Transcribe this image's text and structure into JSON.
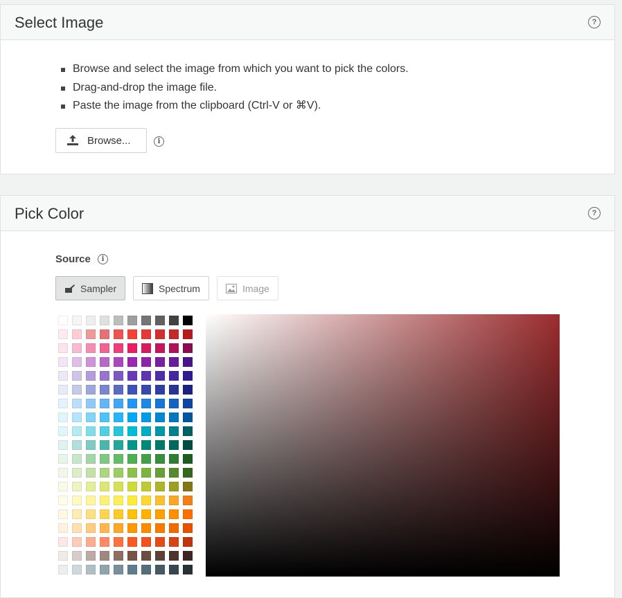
{
  "select_image": {
    "title": "Select Image",
    "instructions": [
      "Browse and select the image from which you want to pick the colors.",
      "Drag-and-drop the image file.",
      "Paste the image from the clipboard (Ctrl-V or ⌘V)."
    ],
    "browse_label": "Browse...",
    "help_icon": "question-circle-icon",
    "info_icon": "info-circle-icon"
  },
  "pick_color": {
    "title": "Pick Color",
    "source_label": "Source",
    "source_options": [
      {
        "label": "Sampler",
        "icon": "sampler-icon",
        "state": "active"
      },
      {
        "label": "Spectrum",
        "icon": "spectrum-icon",
        "state": "normal"
      },
      {
        "label": "Image",
        "icon": "image-icon",
        "state": "disabled"
      }
    ],
    "spectrum_hue_color": "#9b2c2e",
    "palette": [
      [
        "#ffffff",
        "#f5f5f5",
        "#eeeeee",
        "#e0e0e0",
        "#bdbdbd",
        "#9e9e9e",
        "#757575",
        "#616161",
        "#424242",
        "#000000"
      ],
      [
        "#ffebee",
        "#ffcdd2",
        "#ef9a9a",
        "#e57373",
        "#ef5350",
        "#f44336",
        "#e53935",
        "#d32f2f",
        "#c62828",
        "#b71c1c"
      ],
      [
        "#fce4ec",
        "#f8bbd0",
        "#f48fb1",
        "#f06292",
        "#ec407a",
        "#e91e63",
        "#d81b60",
        "#c2185b",
        "#ad1457",
        "#880e4f"
      ],
      [
        "#f3e5f5",
        "#e1bee7",
        "#ce93d8",
        "#ba68c8",
        "#ab47bc",
        "#9c27b0",
        "#8e24aa",
        "#7b1fa2",
        "#6a1b9a",
        "#4a148c"
      ],
      [
        "#ede7f6",
        "#d1c4e9",
        "#b39ddb",
        "#9575cd",
        "#7e57c2",
        "#673ab7",
        "#5e35b1",
        "#512da8",
        "#4527a0",
        "#311b92"
      ],
      [
        "#e8eaf6",
        "#c5cae9",
        "#9fa8da",
        "#7986cb",
        "#5c6bc0",
        "#3f51b5",
        "#3949ab",
        "#303f9f",
        "#283593",
        "#1a237e"
      ],
      [
        "#e3f2fd",
        "#bbdefb",
        "#90caf9",
        "#64b5f6",
        "#42a5f5",
        "#2196f3",
        "#1e88e5",
        "#1976d2",
        "#1565c0",
        "#0d47a1"
      ],
      [
        "#e1f5fe",
        "#b3e5fc",
        "#81d4fa",
        "#4fc3f7",
        "#29b6f6",
        "#03a9f4",
        "#039be5",
        "#0288d1",
        "#0277bd",
        "#01579b"
      ],
      [
        "#e0f7fa",
        "#b2ebf2",
        "#80deea",
        "#4dd0e1",
        "#26c6da",
        "#00bcd4",
        "#00acc1",
        "#0097a7",
        "#00838f",
        "#006064"
      ],
      [
        "#e0f2f1",
        "#b2dfdb",
        "#80cbc4",
        "#4db6ac",
        "#26a69a",
        "#009688",
        "#00897b",
        "#00796b",
        "#00695c",
        "#004d40"
      ],
      [
        "#e8f5e9",
        "#c8e6c9",
        "#a5d6a7",
        "#81c784",
        "#66bb6a",
        "#4caf50",
        "#43a047",
        "#388e3c",
        "#2e7d32",
        "#1b5e20"
      ],
      [
        "#f1f8e9",
        "#dcedc8",
        "#c5e1a5",
        "#aed581",
        "#9ccc65",
        "#8bc34a",
        "#7cb342",
        "#689f38",
        "#558b2f",
        "#33691e"
      ],
      [
        "#f9fbe7",
        "#f0f4c3",
        "#e6ee9c",
        "#dce775",
        "#d4e157",
        "#cddc39",
        "#c0ca33",
        "#afb42b",
        "#9e9d24",
        "#827717"
      ],
      [
        "#fffde7",
        "#fff9c4",
        "#fff59d",
        "#fff176",
        "#ffee58",
        "#ffeb3b",
        "#fdd835",
        "#fbc02d",
        "#f9a825",
        "#f57f17"
      ],
      [
        "#fff8e1",
        "#ffecb3",
        "#ffe082",
        "#ffd54f",
        "#ffca28",
        "#ffc107",
        "#ffb300",
        "#ffa000",
        "#ff8f00",
        "#ff6f00"
      ],
      [
        "#fff3e0",
        "#ffe0b2",
        "#ffcc80",
        "#ffb74d",
        "#ffa726",
        "#ff9800",
        "#fb8c00",
        "#f57c00",
        "#ef6c00",
        "#e65100"
      ],
      [
        "#fbe9e7",
        "#ffccbc",
        "#ffab91",
        "#ff8a65",
        "#ff7043",
        "#ff5722",
        "#f4511e",
        "#e64a19",
        "#d84315",
        "#bf360c"
      ],
      [
        "#efebe9",
        "#d7ccc8",
        "#bcaaa4",
        "#a1887f",
        "#8d6e63",
        "#795548",
        "#6d4c41",
        "#5d4037",
        "#4e342e",
        "#3e2723"
      ],
      [
        "#eceff1",
        "#cfd8dc",
        "#b0bec5",
        "#90a4ae",
        "#78909c",
        "#607d8b",
        "#546e7a",
        "#455a64",
        "#37474f",
        "#263238"
      ]
    ]
  }
}
